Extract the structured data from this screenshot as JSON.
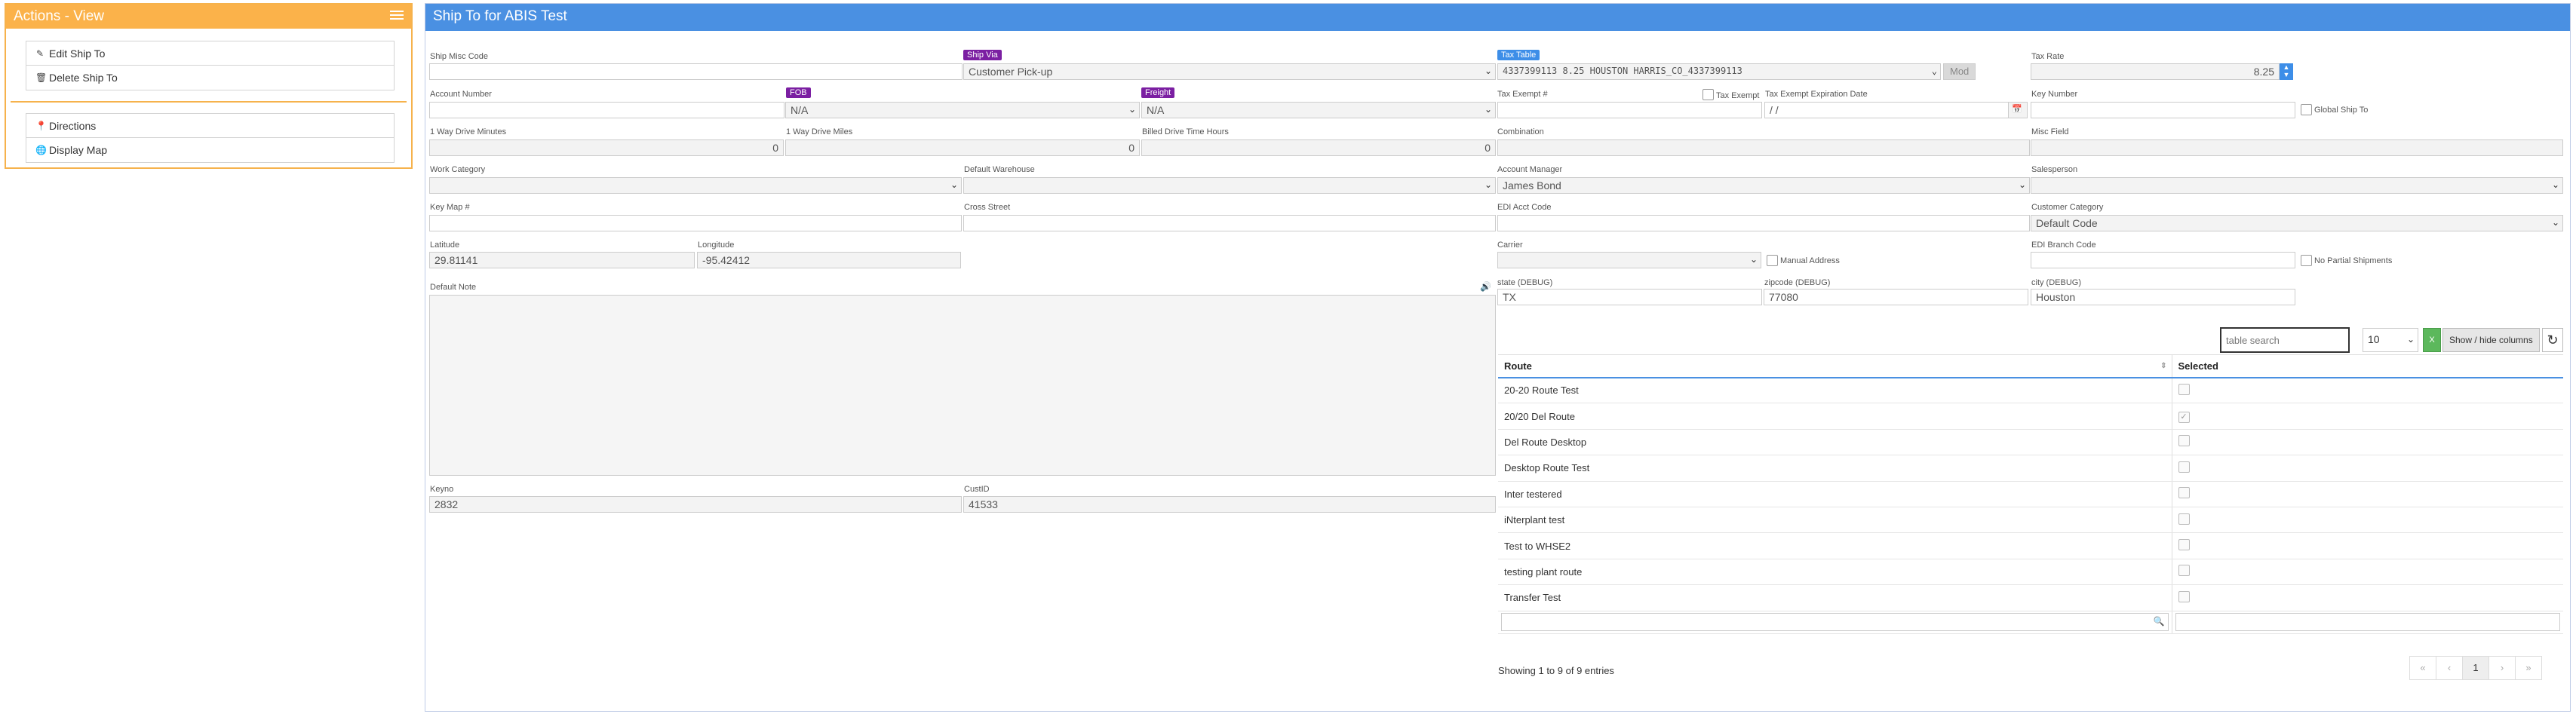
{
  "actions": {
    "title": "Actions - View",
    "group1": [
      {
        "label": "Edit Ship To",
        "icon": "pencil-icon"
      },
      {
        "label": "Delete Ship To",
        "icon": "trash-icon"
      }
    ],
    "group2": [
      {
        "label": "Directions",
        "icon": "map-marker-icon"
      },
      {
        "label": "Display Map",
        "icon": "globe-icon"
      }
    ]
  },
  "main": {
    "title": "Ship To for ABIS Test"
  },
  "form": {
    "ship_misc_code": {
      "label": "Ship Misc Code",
      "value": ""
    },
    "ship_via": {
      "label": "Ship Via",
      "value": "Customer Pick-up"
    },
    "tax_table": {
      "label": "Tax Table",
      "value": "4337399113 8.25       HOUSTON            HARRIS_CO_4337399113",
      "mod_label": "Mod"
    },
    "tax_rate": {
      "label": "Tax Rate",
      "value": "8.25"
    },
    "account_number": {
      "label": "Account Number",
      "value": ""
    },
    "fob": {
      "label": "FOB",
      "value": "N/A"
    },
    "freight": {
      "label": "Freight",
      "value": "N/A"
    },
    "tax_exempt_num": {
      "label": "Tax Exempt #",
      "value": ""
    },
    "tax_exempt": {
      "label": "Tax Exempt"
    },
    "tax_exempt_exp": {
      "label": "Tax Exempt Expiration Date",
      "value": " /  /"
    },
    "key_number": {
      "label": "Key Number",
      "value": ""
    },
    "global_ship_to": {
      "label": "Global Ship To"
    },
    "drive_minutes": {
      "label": "1 Way Drive Minutes",
      "value": "0"
    },
    "drive_miles": {
      "label": "1 Way Drive Miles",
      "value": "0"
    },
    "billed_drive_hours": {
      "label": "Billed Drive Time Hours",
      "value": "0"
    },
    "combination": {
      "label": "Combination",
      "value": ""
    },
    "misc_field": {
      "label": "Misc Field",
      "value": ""
    },
    "work_category": {
      "label": "Work Category",
      "value": ""
    },
    "default_warehouse": {
      "label": "Default Warehouse",
      "value": ""
    },
    "account_manager": {
      "label": "Account Manager",
      "value": "James Bond"
    },
    "salesperson": {
      "label": "Salesperson",
      "value": ""
    },
    "key_map": {
      "label": "Key Map #",
      "value": ""
    },
    "cross_street": {
      "label": "Cross Street",
      "value": ""
    },
    "edi_acct_code": {
      "label": "EDI Acct Code",
      "value": ""
    },
    "customer_category": {
      "label": "Customer Category",
      "value": "Default Code"
    },
    "latitude": {
      "label": "Latitude",
      "value": "29.81141"
    },
    "longitude": {
      "label": "Longitude",
      "value": "-95.42412"
    },
    "carrier": {
      "label": "Carrier",
      "value": ""
    },
    "manual_address": {
      "label": "Manual Address"
    },
    "edi_branch_code": {
      "label": "EDI Branch Code",
      "value": ""
    },
    "no_partial_shipments": {
      "label": "No Partial Shipments"
    },
    "default_note": {
      "label": "Default Note",
      "value": ""
    },
    "state_debug": {
      "label": "state (DEBUG)",
      "value": "TX"
    },
    "zipcode_debug": {
      "label": "zipcode (DEBUG)",
      "value": "77080"
    },
    "city_debug": {
      "label": "city (DEBUG)",
      "value": "Houston"
    },
    "keyno": {
      "label": "Keyno",
      "value": "2832"
    },
    "custid": {
      "label": "CustID",
      "value": "41533"
    }
  },
  "table": {
    "search_placeholder": "table search",
    "page_length": "10",
    "show_hide_label": "Show / hide columns",
    "columns": [
      "Route",
      "Selected"
    ],
    "rows": [
      {
        "route": "20-20 Route Test",
        "selected": false
      },
      {
        "route": "20/20 Del Route",
        "selected": true
      },
      {
        "route": "Del Route Desktop",
        "selected": false
      },
      {
        "route": "Desktop Route Test",
        "selected": false
      },
      {
        "route": "Inter testered",
        "selected": false
      },
      {
        "route": "iNterplant test",
        "selected": false
      },
      {
        "route": "Test to WHSE2",
        "selected": false
      },
      {
        "route": "testing plant route",
        "selected": false
      },
      {
        "route": "Transfer Test",
        "selected": false
      }
    ],
    "showing": "Showing 1 to 9 of 9 entries",
    "pager": [
      "«",
      "‹",
      "1",
      "›",
      "»"
    ],
    "current_page": "1"
  }
}
